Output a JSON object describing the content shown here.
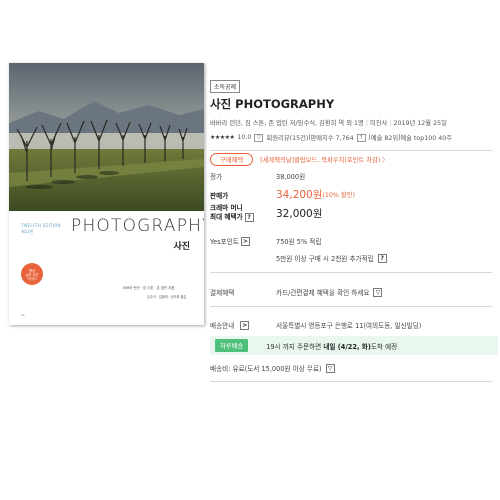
{
  "cover": {
    "edition_label": "TWELFTH EDITION",
    "edition_ko": "제12판",
    "title": "PHOTOGRAPHY",
    "subtitle": "사진",
    "badge": [
      "향상",
      "실무 사진",
      "가이드!"
    ],
    "authors": "바바라 런던 · 짐 스톤 · 존 업턴 지음",
    "translators": "임수식 · 김환희 · 신도희 옮김",
    "publisher_logo": "PS"
  },
  "product": {
    "badge": "소득공제",
    "title": "사진 PHOTOGRAPHY",
    "authors": "바바라 런던, 짐 스톤, 존 업턴 저/임수식, 김환희 역 외 1명",
    "publisher": "미진사",
    "date": "2019년 12월 25일",
    "stars": "★★★★★",
    "rating": "10.0",
    "reviews": "회원리뷰(15건)",
    "sales_index": "판매지수 7,764",
    "rank_art": "예술 82위",
    "rank_top100": "예술 top100 40주"
  },
  "benefits": {
    "tag": "구매혜택",
    "text": "[세계책의날]클립보드, 북파우치(포인트 차감) 〉"
  },
  "price": {
    "list_label": "정가",
    "list_value": "38,000원",
    "sale_label": "판매가",
    "sale_value": "34,200원",
    "sale_pct": "(10% 할인)",
    "cream_label_1": "크레마 머니",
    "cream_label_2": "최대 혜택가",
    "cream_value": "32,000원"
  },
  "points": {
    "label": "Yes포인트",
    "value": "750원 5% 적립",
    "extra": "5만원 이상 구매 시 2천원 추가적립"
  },
  "payment": {
    "label": "결제혜택",
    "value": "카드/간편결제 혜택을 확인 하세요"
  },
  "delivery": {
    "label": "배송안내",
    "value": "서울특별시 영등포구 은행로 11(여의도동, 일신빌딩)",
    "today_tag": "하루배송",
    "today_text_a": "19시 까지 주문하면 ",
    "today_text_b": "내일 (4/22, 화)",
    "today_text_c": "도착 예정",
    "fee": "배송비: 유료(도서 15,000원 이상 무료)"
  },
  "icons": {
    "help": "?",
    "arrow": ">",
    "dropdown": "▽"
  },
  "colors": {
    "accent": "#e8623a",
    "today_bg": "#e9f7ef",
    "today_tag": "#4fc07a"
  }
}
